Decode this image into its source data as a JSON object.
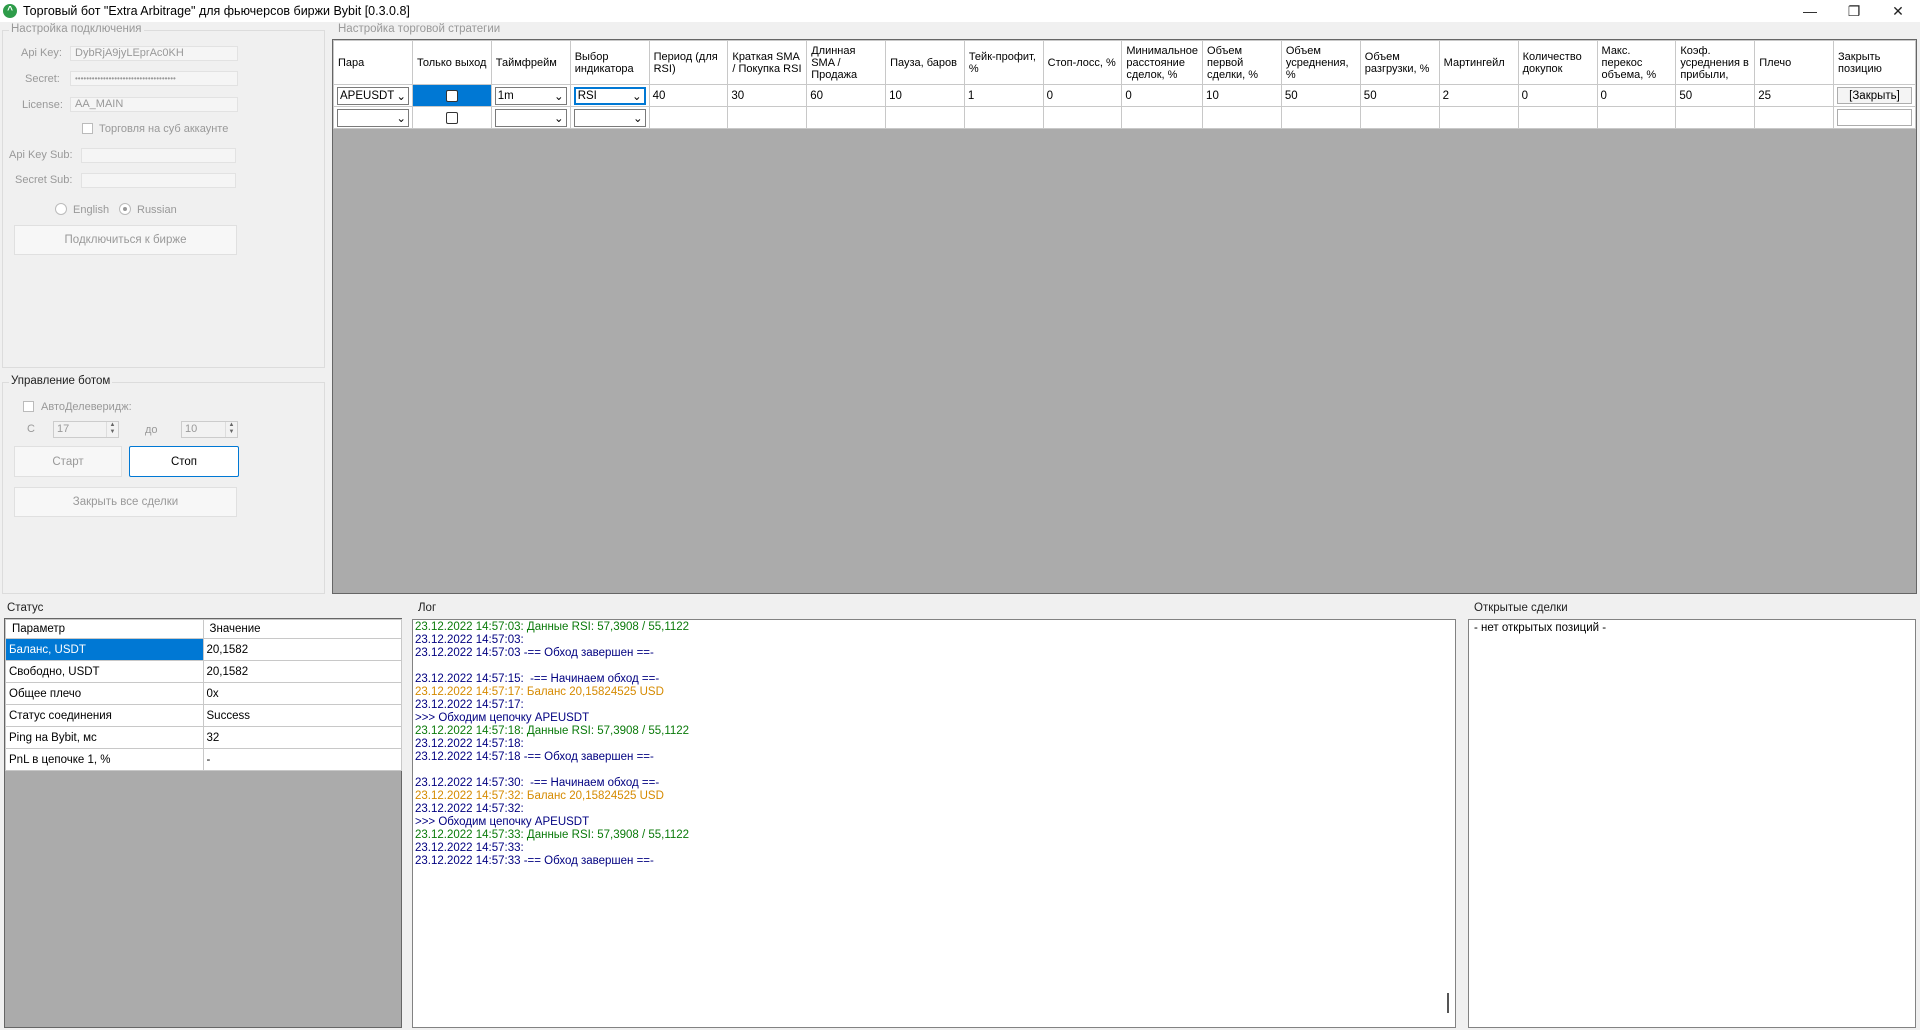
{
  "window": {
    "title": "Торговый бот \"Extra Arbitrage\" для фьючерсов биржи Bybit [0.3.0.8]"
  },
  "connection": {
    "group_title": "Настройка подключения",
    "api_key_label": "Api Key:",
    "api_key_value": "DybRjA9jyLEprAc0KH",
    "secret_label": "Secret:",
    "secret_value": "••••••••••••••••••••••••••••••••••••",
    "license_label": "License:",
    "license_value": "AA_MAIN",
    "sub_account_label": "Торговля на суб аккаунте",
    "api_key_sub_label": "Api Key Sub:",
    "secret_sub_label": "Secret Sub:",
    "lang_english": "English",
    "lang_russian": "Russian",
    "connect_button": "Подключиться к бирже"
  },
  "bot_control": {
    "group_title": "Управление ботом",
    "auto_deleverage_label": "АвтоДелеверидж:",
    "from_label": "С",
    "from_value": "17",
    "to_label": "до",
    "to_value": "10",
    "start_button": "Старт",
    "stop_button": "Стоп",
    "close_all_button": "Закрыть все сделки"
  },
  "strategy": {
    "group_title": "Настройка торговой стратегии",
    "columns": [
      "Пара",
      "Только выход",
      "Таймфрейм",
      "Выбор индикатора",
      "Период (для RSI)",
      "Краткая SMA / Покупка RSI",
      "Длинная SMA / Продажа",
      "Пауза, баров",
      "Тейк-профит, %",
      "Стоп-лосс, %",
      "Минимальное расстояние сделок, %",
      "Объем первой сделки, %",
      "Объем усреднения, %",
      "Объем разгрузки, %",
      "Мартингейл",
      "Количество докупок",
      "Макс. перекос объема, %",
      "Коэф. усреднения в прибыли,",
      "Плечо",
      "Закрыть позицию"
    ],
    "row": {
      "pair": "APEUSDT",
      "timeframe": "1m",
      "indicator": "RSI",
      "period": "40",
      "short_sma": "30",
      "long_sma": "60",
      "pause": "10",
      "take_profit": "1",
      "stop_loss": "0",
      "min_distance": "0",
      "first_volume": "10",
      "avg_volume": "50",
      "unload_volume": "50",
      "martingale": "2",
      "rebuys": "0",
      "max_skew": "0",
      "avg_coef": "50",
      "leverage": "25",
      "close_label": "[Закрыть]"
    }
  },
  "status": {
    "title": "Статус",
    "col_param": "Параметр",
    "col_value": "Значение",
    "rows": [
      {
        "param": "Баланс, USDT",
        "value": "20,1582"
      },
      {
        "param": "Свободно, USDT",
        "value": "20,1582"
      },
      {
        "param": "Общее плечо",
        "value": "0x"
      },
      {
        "param": "Статус соединения",
        "value": "Success"
      },
      {
        "param": "Ping на Bybit, мс",
        "value": "32"
      },
      {
        "param": "PnL в цепочке 1, %",
        "value": "-"
      }
    ]
  },
  "log": {
    "title": "Лог",
    "lines": [
      {
        "text": "23.12.2022 14:57:03: Данные RSI: 57,3908 / 55,1122",
        "color": "green"
      },
      {
        "text": "23.12.2022 14:57:03:",
        "color": "navy"
      },
      {
        "text": "23.12.2022 14:57:03 -== Обход завершен ==-",
        "color": "navy"
      },
      {
        "text": "",
        "color": "navy"
      },
      {
        "text": "23.12.2022 14:57:15:  -== Начинаем обход ==-",
        "color": "navy"
      },
      {
        "text": "23.12.2022 14:57:17: Баланс 20,15824525 USD",
        "color": "orange"
      },
      {
        "text": "23.12.2022 14:57:17:",
        "color": "navy"
      },
      {
        "text": ">>> Обходим цепочку APEUSDT",
        "color": "navy"
      },
      {
        "text": "23.12.2022 14:57:18: Данные RSI: 57,3908 / 55,1122",
        "color": "green"
      },
      {
        "text": "23.12.2022 14:57:18:",
        "color": "navy"
      },
      {
        "text": "23.12.2022 14:57:18 -== Обход завершен ==-",
        "color": "navy"
      },
      {
        "text": "",
        "color": "navy"
      },
      {
        "text": "23.12.2022 14:57:30:  -== Начинаем обход ==-",
        "color": "navy"
      },
      {
        "text": "23.12.2022 14:57:32: Баланс 20,15824525 USD",
        "color": "orange"
      },
      {
        "text": "23.12.2022 14:57:32:",
        "color": "navy"
      },
      {
        "text": ">>> Обходим цепочку APEUSDT",
        "color": "navy"
      },
      {
        "text": "23.12.2022 14:57:33: Данные RSI: 57,3908 / 55,1122",
        "color": "green"
      },
      {
        "text": "23.12.2022 14:57:33:",
        "color": "navy"
      },
      {
        "text": "23.12.2022 14:57:33 -== Обход завершен ==-",
        "color": "navy"
      }
    ]
  },
  "open_trades": {
    "title": "Открытые сделки",
    "empty_text": "- нет открытых позиций -"
  }
}
